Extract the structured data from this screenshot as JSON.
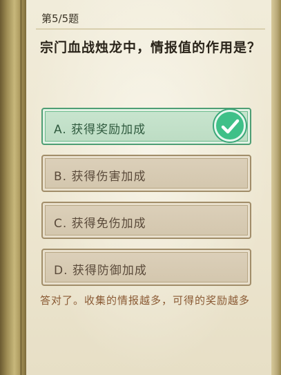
{
  "quiz": {
    "counter": "第5/5题",
    "question": "宗门血战烛龙中，情报值的作用是？",
    "options": [
      {
        "label": "A. 获得奖励加成",
        "state": "correct"
      },
      {
        "label": "B. 获得伤害加成",
        "state": "normal"
      },
      {
        "label": "C. 获得免伤加成",
        "state": "normal"
      },
      {
        "label": "D. 获得防御加成",
        "state": "normal"
      }
    ],
    "explanation": "答对了。收集的情报越多，可得的奖励越多"
  },
  "colors": {
    "paper": "#efe9d6",
    "option_normal": "#d8ccb4",
    "option_correct": "#c3e1c9",
    "check_badge": "#3fc088",
    "explanation_text": "#8a5a34"
  },
  "icons": {
    "correct_mark": "checkmark-icon"
  }
}
